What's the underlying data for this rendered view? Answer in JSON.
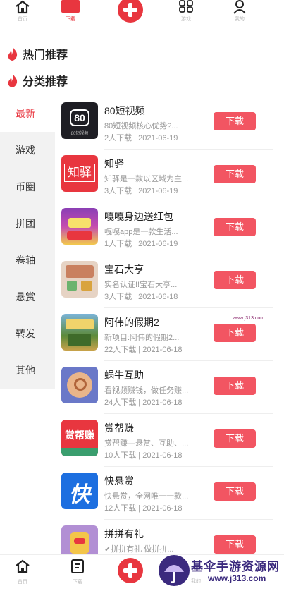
{
  "top_nav": {
    "items": [
      {
        "label": "首页",
        "icon": "home-icon"
      },
      {
        "label": "下载",
        "icon": "download-icon"
      },
      {
        "label": "",
        "icon": "plus-icon"
      },
      {
        "label": "游戏",
        "icon": "grid-icon"
      },
      {
        "label": "我的",
        "icon": "user-icon"
      }
    ]
  },
  "sections": {
    "hot": "热门推荐",
    "category": "分类推荐"
  },
  "categories": [
    "最新",
    "游戏",
    "币圈",
    "拼团",
    "卷轴",
    "悬赏",
    "转发",
    "其他"
  ],
  "active_category": "最新",
  "download_label": "下载",
  "apps": [
    {
      "name": "80短视频",
      "desc": "80短视频核心优势?...",
      "meta": "2人下载 | 2021-06-19",
      "icon_text": "80",
      "icon_sub": "80短视频",
      "icon_bg": "#1e1e24"
    },
    {
      "name": "知驿",
      "desc": "知驿是一款以区域为主...",
      "meta": "3人下载 | 2021-06-19",
      "icon_text": "知驿",
      "icon_sub": "",
      "icon_bg": "#e8363f"
    },
    {
      "name": "嘎嘎身边送红包",
      "desc": "嘎嘎app是一款生活...",
      "meta": "1人下载 | 2021-06-19",
      "icon_text": "",
      "icon_sub": "",
      "icon_bg": "#8a3fb5"
    },
    {
      "name": "宝石大亨",
      "desc": "实名认证!!宝石大亨...",
      "meta": "3人下载 | 2021-06-18",
      "icon_text": "",
      "icon_sub": "",
      "icon_bg": "#e6d3c4"
    },
    {
      "name": "阿伟的假期2",
      "desc": "新项目:阿伟的假期2...",
      "meta": "22人下载 | 2021-06-18",
      "icon_text": "",
      "icon_sub": "",
      "icon_bg": "#5c8a3a"
    },
    {
      "name": "蜗牛互助",
      "desc": "看视频赚钱，做任务赚...",
      "meta": "24人下载 | 2021-06-18",
      "icon_text": "",
      "icon_sub": "",
      "icon_bg": "#6a78c8"
    },
    {
      "name": "赏帮赚",
      "desc": "赏帮赚—悬赏、互助、...",
      "meta": "10人下载 | 2021-06-18",
      "icon_text": "赏帮赚",
      "icon_sub": "",
      "icon_bg": "#e8363f"
    },
    {
      "name": "快悬赏",
      "desc": "快悬赏，全网唯一一款...",
      "meta": "12人下载 | 2021-06-18",
      "icon_text": "快",
      "icon_sub": "",
      "icon_bg": "#1d6fe0"
    },
    {
      "name": "拼拼有礼",
      "desc": "✔拼拼有礼 做拼拼...",
      "meta": "",
      "icon_text": "",
      "icon_sub": "",
      "icon_bg": "#f3c54a"
    }
  ],
  "bottom_nav": {
    "items": [
      {
        "label": "首页",
        "icon": "home-icon"
      },
      {
        "label": "下载",
        "icon": "download-icon"
      },
      {
        "label": "",
        "icon": "plus-icon"
      },
      {
        "label": "我的",
        "icon": "user-icon"
      }
    ]
  },
  "watermark": {
    "small": "www.j313.com",
    "title": "基伞手游资源网",
    "url": "www.j313.com"
  },
  "colors": {
    "accent": "#e8363f",
    "download_button": "#f25562",
    "sidebar_bg": "#f2f2f2"
  }
}
